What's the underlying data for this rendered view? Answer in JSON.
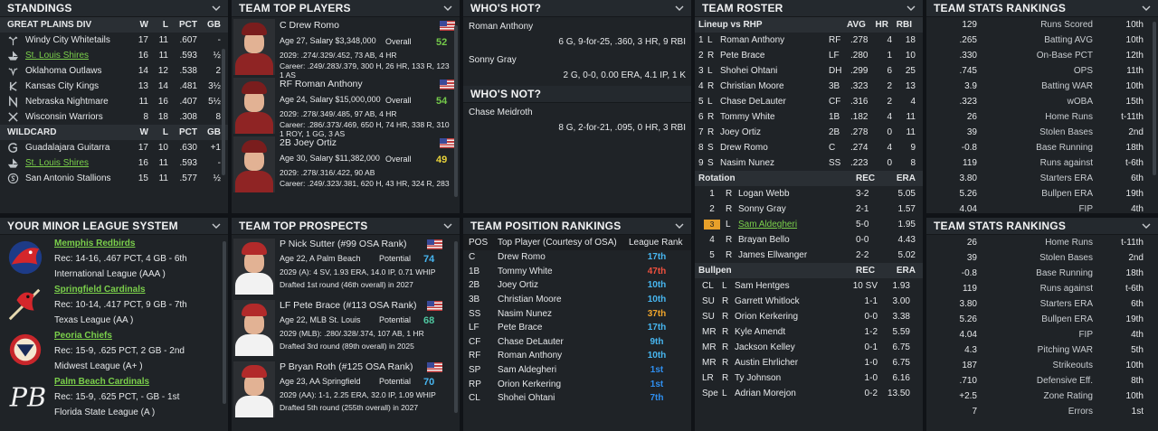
{
  "standings": {
    "title": "STANDINGS",
    "division": "GREAT PLAINS DIV",
    "cols": [
      "W",
      "L",
      "PCT",
      "GB"
    ],
    "teams": [
      {
        "name": "Windy City Whitetails",
        "w": "17",
        "l": "11",
        "pct": ".607",
        "gb": "-",
        "link": false,
        "icon": "antlers-icon"
      },
      {
        "name": "St. Louis Shires",
        "w": "16",
        "l": "11",
        "pct": ".593",
        "gb": "½",
        "link": true,
        "icon": "ship-icon"
      },
      {
        "name": "Oklahoma Outlaws",
        "w": "14",
        "l": "12",
        "pct": ".538",
        "gb": "2",
        "link": false,
        "icon": "bull-icon"
      },
      {
        "name": "Kansas City Kings",
        "w": "13",
        "l": "14",
        "pct": ".481",
        "gb": "3½",
        "link": false,
        "icon": "k-logo-icon"
      },
      {
        "name": "Nebraska Nightmare",
        "w": "11",
        "l": "16",
        "pct": ".407",
        "gb": "5½",
        "link": false,
        "icon": "n-logo-icon"
      },
      {
        "name": "Wisconsin Warriors",
        "w": "8",
        "l": "18",
        "pct": ".308",
        "gb": "8",
        "link": false,
        "icon": "crossed-icon"
      }
    ],
    "wildcard_title": "WILDCARD",
    "wildcard": [
      {
        "name": "Guadalajara Guitarra",
        "w": "17",
        "l": "10",
        "pct": ".630",
        "gb": "+1",
        "link": false,
        "icon": "g-logo-icon"
      },
      {
        "name": "St. Louis Shires",
        "w": "16",
        "l": "11",
        "pct": ".593",
        "gb": "-",
        "link": true,
        "icon": "ship-icon"
      },
      {
        "name": "San Antonio Stallions",
        "w": "15",
        "l": "11",
        "pct": ".577",
        "gb": "½",
        "link": false,
        "icon": "s-logo-icon"
      }
    ]
  },
  "top_players": {
    "title": "TEAM TOP PLAYERS",
    "players": [
      {
        "name": "C Drew Romo",
        "info": "Age 27, Salary $3,348,000",
        "label": "Overall",
        "rating": "52",
        "line1": "2029: .274/.329/.452, 73 AB, 4 HR",
        "line2": "Career: .249/.283/.379, 300 H, 26 HR, 133 R, 123 RBI",
        "line3": "1 AS",
        "rating_color": "#74c94a"
      },
      {
        "name": "RF Roman Anthony",
        "info": "Age 24, Salary $15,000,000",
        "label": "Overall",
        "rating": "54",
        "line1": "2029: .278/.349/.485, 97 AB, 4 HR",
        "line2": "Career: .286/.373/.469, 650 H, 74 HR, 338 R, 310 RBI",
        "line3": "1 ROY, 1 GG, 3 AS",
        "rating_color": "#74c94a"
      },
      {
        "name": "2B Joey Ortiz",
        "info": "Age 30, Salary $11,382,000",
        "label": "Overall",
        "rating": "49",
        "line1": "2029: .278/.316/.422, 90 AB",
        "line2": "Career: .249/.323/.381, 620 H, 43 HR, 324 R, 283 RBI",
        "line3": "",
        "rating_color": "#e9d33a"
      }
    ]
  },
  "hot": {
    "title": "WHO'S HOT?",
    "players": [
      {
        "name": "Roman Anthony",
        "line": "6 G, 9-for-25, .360, 3 HR, 9 RBI"
      },
      {
        "name": "Sonny Gray",
        "line": "2 G, 0-0, 0.00 ERA, 4.1 IP, 1 K"
      }
    ],
    "not_title": "WHO'S NOT?",
    "not_players": [
      {
        "name": "Chase Meidroth",
        "line": "8 G, 2-for-21, .095, 0 HR, 3 RBI"
      }
    ]
  },
  "roster": {
    "title": "TEAM ROSTER",
    "lineup_title": "Lineup vs RHP",
    "lineup_cols": [
      "AVG",
      "HR",
      "RBI"
    ],
    "lineup": [
      {
        "n": "1",
        "h": "L",
        "name": "Roman Anthony",
        "pos": "RF",
        "avg": ".278",
        "hr": "4",
        "rbi": "18"
      },
      {
        "n": "2",
        "h": "R",
        "name": "Pete Brace",
        "pos": "LF",
        "avg": ".280",
        "hr": "1",
        "rbi": "10"
      },
      {
        "n": "3",
        "h": "L",
        "name": "Shohei Ohtani",
        "pos": "DH",
        "avg": ".299",
        "hr": "6",
        "rbi": "25"
      },
      {
        "n": "4",
        "h": "R",
        "name": "Christian Moore",
        "pos": "3B",
        "avg": ".323",
        "hr": "2",
        "rbi": "13"
      },
      {
        "n": "5",
        "h": "L",
        "name": "Chase DeLauter",
        "pos": "CF",
        "avg": ".316",
        "hr": "2",
        "rbi": "4"
      },
      {
        "n": "6",
        "h": "R",
        "name": "Tommy White",
        "pos": "1B",
        "avg": ".182",
        "hr": "4",
        "rbi": "11"
      },
      {
        "n": "7",
        "h": "R",
        "name": "Joey Ortiz",
        "pos": "2B",
        "avg": ".278",
        "hr": "0",
        "rbi": "11"
      },
      {
        "n": "8",
        "h": "S",
        "name": "Drew Romo",
        "pos": "C",
        "avg": ".274",
        "hr": "4",
        "rbi": "9"
      },
      {
        "n": "9",
        "h": "S",
        "name": "Nasim Nunez",
        "pos": "SS",
        "avg": ".223",
        "hr": "0",
        "rbi": "8"
      }
    ],
    "rotation_title": "Rotation",
    "rotation_cols": [
      "REC",
      "ERA"
    ],
    "rotation": [
      {
        "n": "1",
        "h": "R",
        "name": "Logan Webb",
        "rec": "3-2",
        "era": "5.05",
        "badge": false,
        "link": false
      },
      {
        "n": "2",
        "h": "R",
        "name": "Sonny Gray",
        "rec": "2-1",
        "era": "1.57",
        "badge": false,
        "link": false
      },
      {
        "n": "3",
        "h": "L",
        "name": "Sam Aldegheri",
        "rec": "5-0",
        "era": "1.95",
        "badge": true,
        "link": true
      },
      {
        "n": "4",
        "h": "R",
        "name": "Brayan Bello",
        "rec": "0-0",
        "era": "4.43",
        "badge": false,
        "link": false
      },
      {
        "n": "5",
        "h": "R",
        "name": "James Ellwanger",
        "rec": "2-2",
        "era": "5.02",
        "badge": false,
        "link": false
      }
    ],
    "bullpen_title": "Bullpen",
    "bullpen_cols": [
      "REC",
      "ERA"
    ],
    "bullpen": [
      {
        "n": "CL",
        "h": "L",
        "name": "Sam Hentges",
        "rec": "10 SV",
        "era": "1.93"
      },
      {
        "n": "SU",
        "h": "R",
        "name": "Garrett Whitlock",
        "rec": "1-1",
        "era": "3.00"
      },
      {
        "n": "SU",
        "h": "R",
        "name": "Orion Kerkering",
        "rec": "0-0",
        "era": "3.38"
      },
      {
        "n": "MR",
        "h": "R",
        "name": "Kyle Amendt",
        "rec": "1-2",
        "era": "5.59"
      },
      {
        "n": "MR",
        "h": "R",
        "name": "Jackson Kelley",
        "rec": "0-1",
        "era": "6.75"
      },
      {
        "n": "MR",
        "h": "R",
        "name": "Austin Ehrlicher",
        "rec": "1-0",
        "era": "6.75"
      },
      {
        "n": "LR",
        "h": "R",
        "name": "Ty Johnson",
        "rec": "1-0",
        "era": "6.16"
      },
      {
        "n": "Spe",
        "h": "L",
        "name": "Adrian Morejon",
        "rec": "0-2",
        "era": "13.50"
      }
    ]
  },
  "stats1": {
    "title": "TEAM STATS RANKINGS",
    "rows": [
      {
        "v": "129",
        "stat": "Runs Scored",
        "rank": "10th"
      },
      {
        "v": ".265",
        "stat": "Batting AVG",
        "rank": "10th"
      },
      {
        "v": ".330",
        "stat": "On-Base PCT",
        "rank": "12th"
      },
      {
        "v": ".745",
        "stat": "OPS",
        "rank": "11th"
      },
      {
        "v": "3.9",
        "stat": "Batting WAR",
        "rank": "10th"
      },
      {
        "v": ".323",
        "stat": "wOBA",
        "rank": "15th"
      },
      {
        "v": "26",
        "stat": "Home Runs",
        "rank": "t-11th"
      },
      {
        "v": "39",
        "stat": "Stolen Bases",
        "rank": "2nd"
      },
      {
        "v": "-0.8",
        "stat": "Base Running",
        "rank": "18th"
      },
      {
        "v": "119",
        "stat": "Runs against",
        "rank": "t-6th"
      },
      {
        "v": "3.80",
        "stat": "Starters ERA",
        "rank": "6th"
      },
      {
        "v": "5.26",
        "stat": "Bullpen ERA",
        "rank": "19th"
      },
      {
        "v": "4.04",
        "stat": "FIP",
        "rank": "4th"
      }
    ]
  },
  "stats2": {
    "title": "TEAM STATS RANKINGS",
    "rows": [
      {
        "v": "26",
        "stat": "Home Runs",
        "rank": "t-11th"
      },
      {
        "v": "39",
        "stat": "Stolen Bases",
        "rank": "2nd"
      },
      {
        "v": "-0.8",
        "stat": "Base Running",
        "rank": "18th"
      },
      {
        "v": "119",
        "stat": "Runs against",
        "rank": "t-6th"
      },
      {
        "v": "3.80",
        "stat": "Starters ERA",
        "rank": "6th"
      },
      {
        "v": "5.26",
        "stat": "Bullpen ERA",
        "rank": "19th"
      },
      {
        "v": "4.04",
        "stat": "FIP",
        "rank": "4th"
      },
      {
        "v": "4.3",
        "stat": "Pitching WAR",
        "rank": "5th"
      },
      {
        "v": "187",
        "stat": "Strikeouts",
        "rank": "10th"
      },
      {
        "v": ".710",
        "stat": "Defensive Eff.",
        "rank": "8th"
      },
      {
        "v": "+2.5",
        "stat": "Zone Rating",
        "rank": "10th"
      },
      {
        "v": "7",
        "stat": "Errors",
        "rank": "1st"
      }
    ]
  },
  "minors": {
    "title": "YOUR MINOR LEAGUE SYSTEM",
    "teams": [
      {
        "name": "Memphis Redbirds",
        "rec": "Rec: 14-16, .467 PCT, 4 GB - 6th",
        "league": "International League (AAA )",
        "logo": "redbird-logo-icon"
      },
      {
        "name": "Springfield Cardinals",
        "rec": "Rec: 10-14, .417 PCT, 9 GB - 7th",
        "league": "Texas League (AA )",
        "logo": "cardinal-bat-logo-icon"
      },
      {
        "name": "Peoria Chiefs",
        "rec": "Rec: 15-9, .625 PCT, 2 GB - 2nd",
        "league": "Midwest League (A+ )",
        "logo": "chiefs-logo-icon"
      },
      {
        "name": "Palm Beach Cardinals",
        "rec": "Rec: 15-9, .625 PCT, - GB - 1st",
        "league": "Florida State League (A )",
        "logo": "pb-logo-icon"
      }
    ]
  },
  "prospects": {
    "title": "TEAM TOP PROSPECTS",
    "players": [
      {
        "name": "P Nick Sutter (#99 OSA Rank)",
        "info": "Age 22, A Palm Beach",
        "label": "Potential",
        "rating": "74",
        "line1": "2029 (A): 4 SV, 1.93 ERA, 14.0 IP, 0.71 WHIP",
        "line2": "Drafted 1st round (46th overall) in 2027",
        "rating_color": "#47b6f0"
      },
      {
        "name": "LF Pete Brace (#113 OSA Rank)",
        "info": "Age 22, MLB St. Louis",
        "label": "Potential",
        "rating": "68",
        "line1": "2029 (MLB): .280/.328/.374, 107 AB, 1 HR",
        "line2": "Drafted 3rd round (89th overall) in 2025",
        "rating_color": "#4fc6a0"
      },
      {
        "name": "P Bryan Roth (#125 OSA Rank)",
        "info": "Age 23, AA Springfield",
        "label": "Potential",
        "rating": "70",
        "line1": "2029 (AA): 1-1, 2.25 ERA, 32.0 IP, 1.09 WHIP",
        "line2": "Drafted 5th round (255th overall) in 2027",
        "rating_color": "#47b6f0"
      }
    ]
  },
  "positions": {
    "title": "TEAM POSITION RANKINGS",
    "cols": [
      "POS",
      "Top Player (Courtesy of OSA)",
      "League Rank"
    ],
    "rows": [
      {
        "pos": "C",
        "player": "Drew Romo",
        "rank": "17th",
        "color": "#47b6f0"
      },
      {
        "pos": "1B",
        "player": "Tommy White",
        "rank": "47th",
        "color": "#f0503e"
      },
      {
        "pos": "2B",
        "player": "Joey Ortiz",
        "rank": "10th",
        "color": "#47b6f0"
      },
      {
        "pos": "3B",
        "player": "Christian Moore",
        "rank": "10th",
        "color": "#47b6f0"
      },
      {
        "pos": "SS",
        "player": "Nasim Nunez",
        "rank": "37th",
        "color": "#f0a52b"
      },
      {
        "pos": "LF",
        "player": "Pete Brace",
        "rank": "17th",
        "color": "#47b6f0"
      },
      {
        "pos": "CF",
        "player": "Chase DeLauter",
        "rank": "9th",
        "color": "#47b6f0"
      },
      {
        "pos": "RF",
        "player": "Roman Anthony",
        "rank": "10th",
        "color": "#47b6f0"
      },
      {
        "pos": "SP",
        "player": "Sam Aldegheri",
        "rank": "1st",
        "color": "#2f8ff0"
      },
      {
        "pos": "RP",
        "player": "Orion Kerkering",
        "rank": "1st",
        "color": "#2f8ff0"
      },
      {
        "pos": "CL",
        "player": "Shohei Ohtani",
        "rank": "7th",
        "color": "#2f8ff0"
      }
    ]
  }
}
